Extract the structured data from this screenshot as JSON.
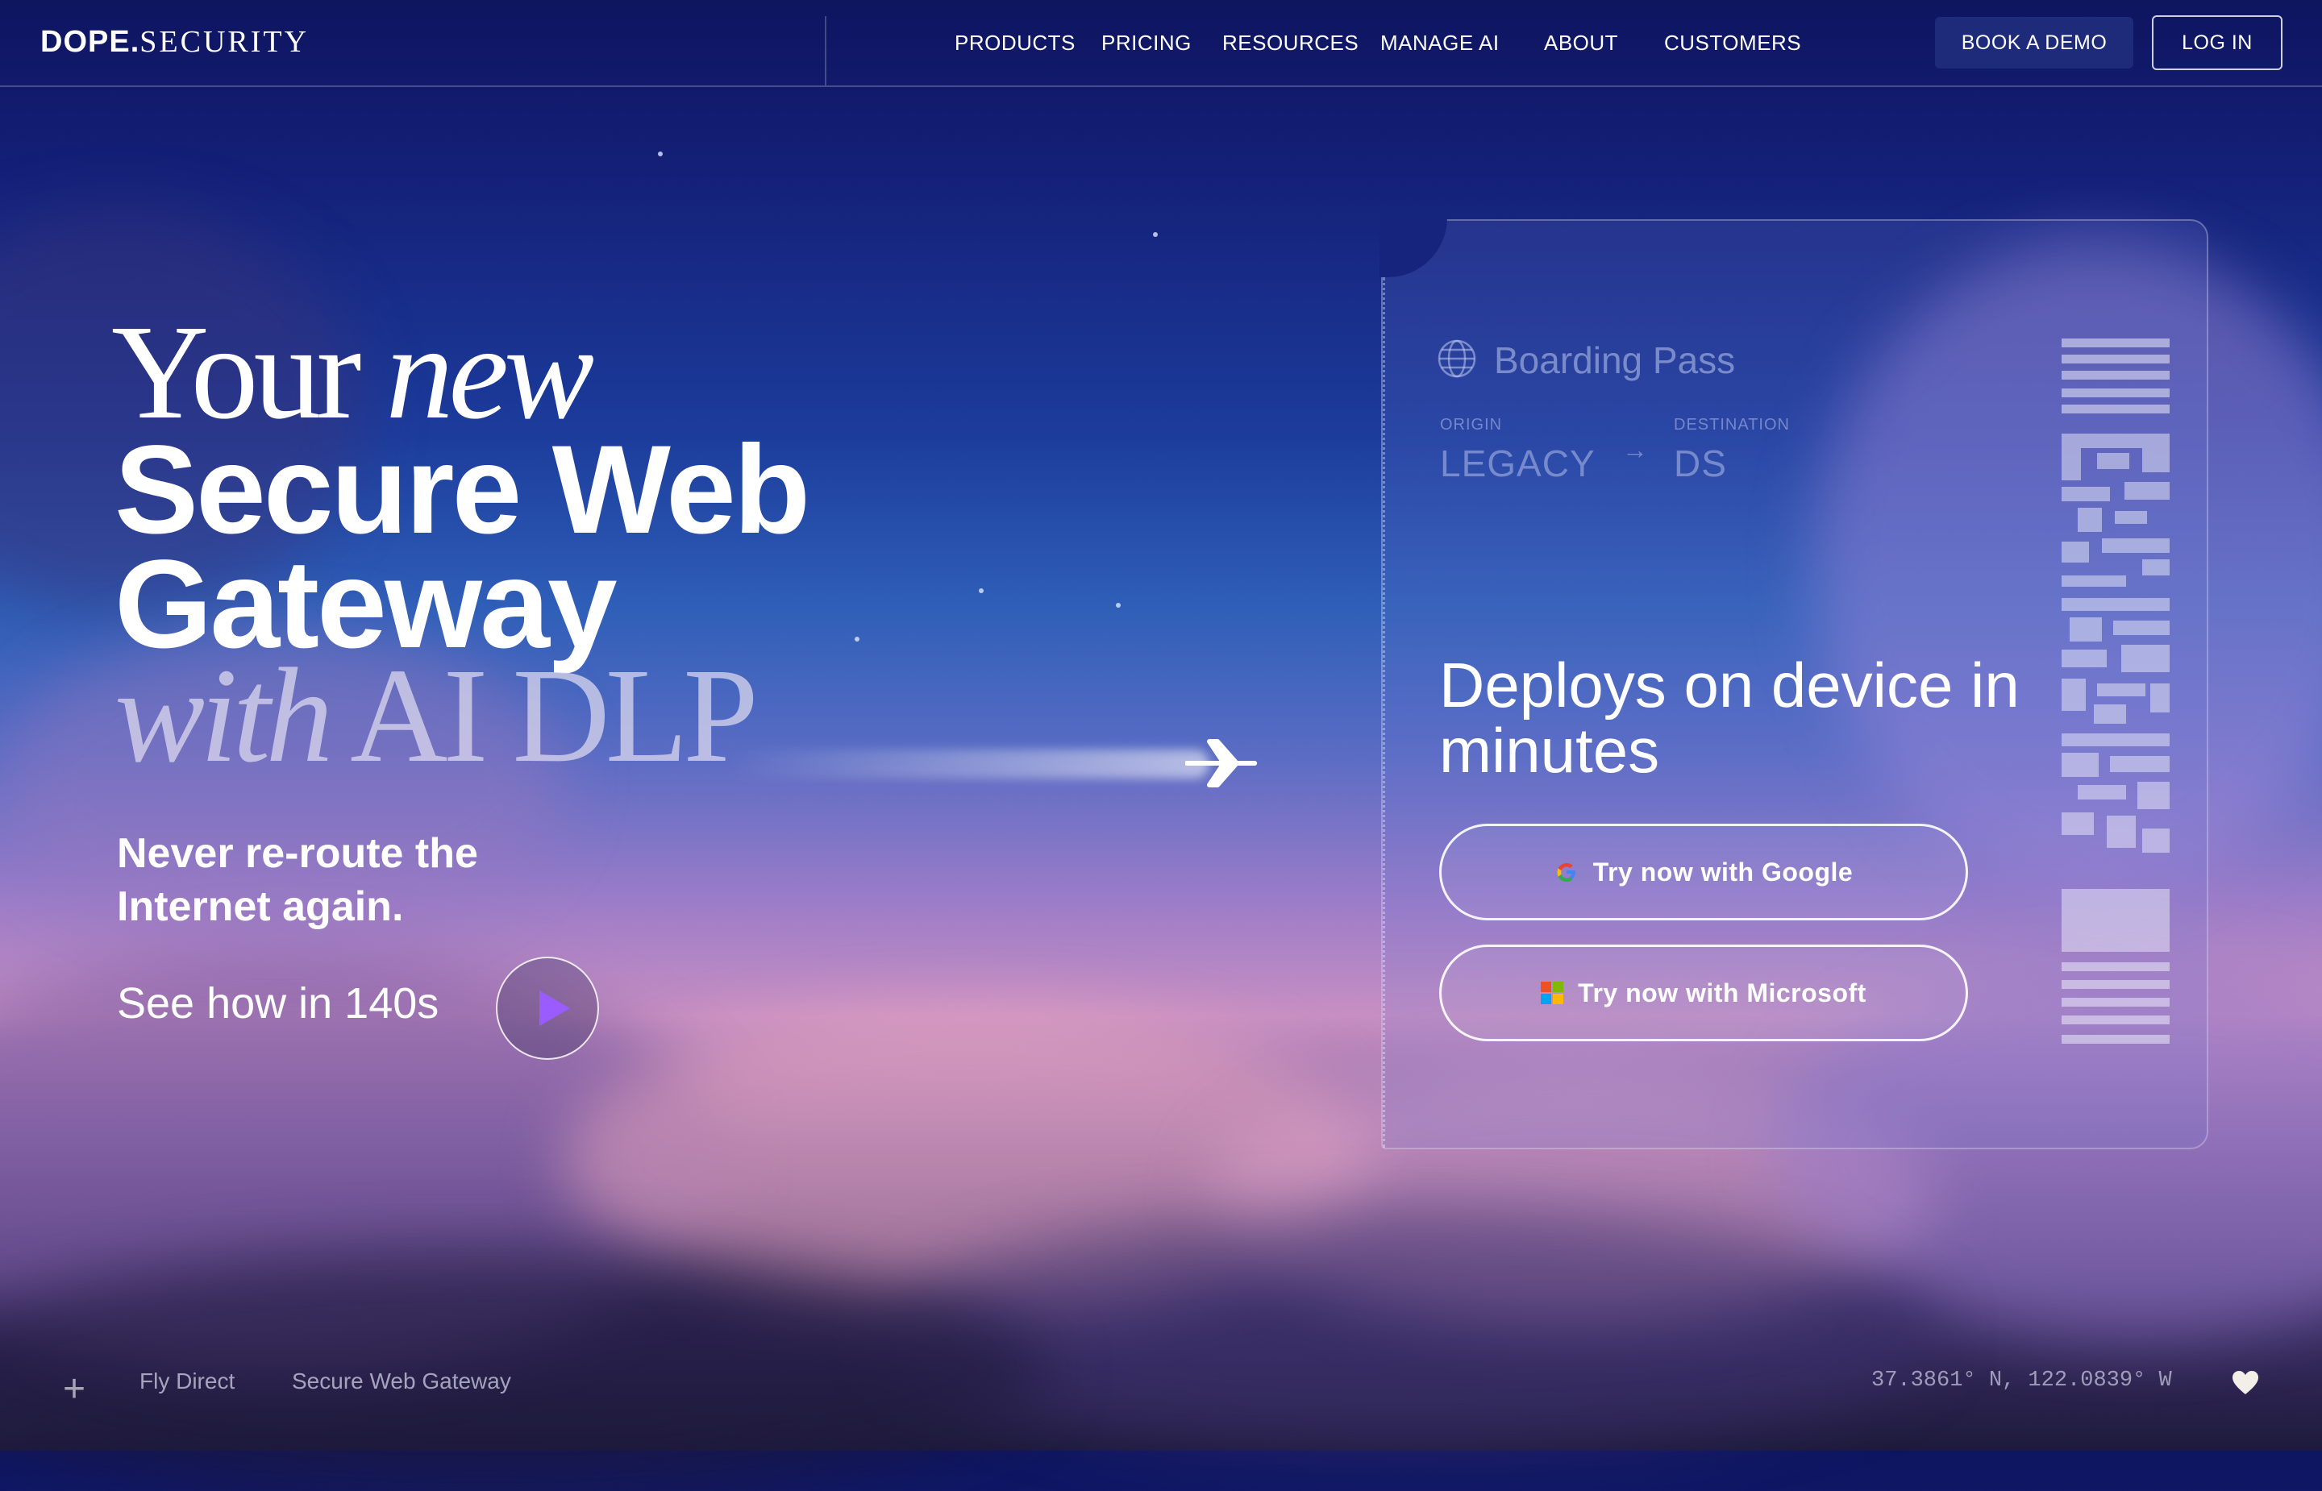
{
  "nav": {
    "logo_bold": "DOPE.",
    "logo_light": "SECURITY",
    "links": [
      "PRODUCTS",
      "PRICING",
      "RESOURCES",
      "MANAGE AI",
      "ABOUT",
      "CUSTOMERS"
    ],
    "book_demo": "BOOK A DEMO",
    "log_in": "LOG IN"
  },
  "hero": {
    "line1_a": "Your",
    "line1_b": "new",
    "line2": "Secure Web",
    "line3": "Gateway",
    "line4_a": "with",
    "line4_b": "AI DLP",
    "subheading": "Never re-route the Internet again.",
    "see_how": "See how in 140s"
  },
  "pass": {
    "title": "Boarding Pass",
    "origin_label": "ORIGIN",
    "origin": "LEGACY",
    "arrow": "→",
    "destination_label": "DESTINATION",
    "destination": "DS",
    "headline": "Deploys on device in minutes",
    "google_cta": "Try now with Google",
    "microsoft_cta": "Try now with Microsoft"
  },
  "footer": {
    "tag1": "Fly Direct",
    "tag2": "Secure Web Gateway",
    "coordinates": "37.3861° N, 122.0839° W"
  },
  "colors": {
    "accent_play": "#9b5cff",
    "demo_button": "#1e2a7a"
  },
  "icons": [
    "plus-icon",
    "play-icon",
    "globe-icon",
    "google-icon",
    "microsoft-icon",
    "heart-icon",
    "airplane-icon"
  ]
}
